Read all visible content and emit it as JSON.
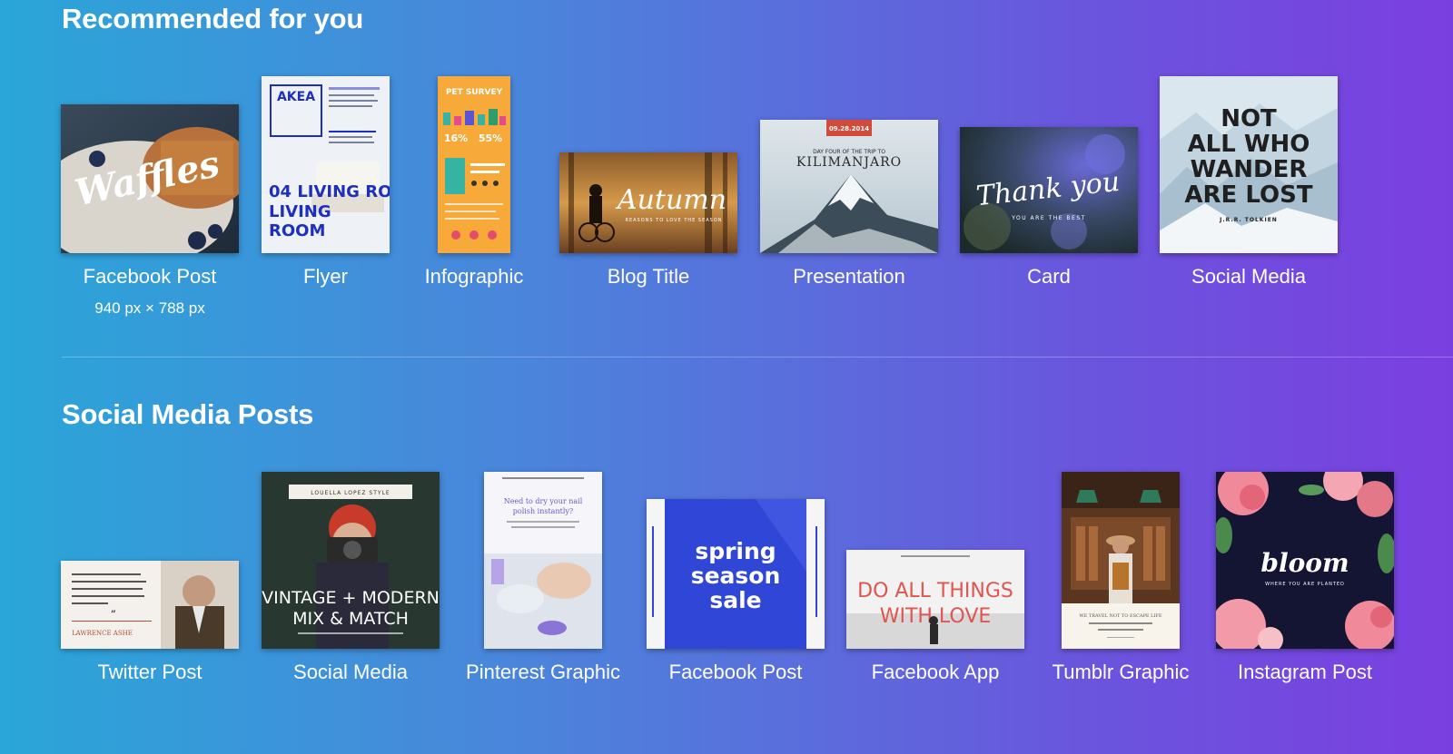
{
  "sections": [
    {
      "title": "Recommended for you",
      "items": [
        {
          "label": "Facebook Post",
          "sublabel": "940 px × 788 px",
          "thumb_text": "Waffles"
        },
        {
          "label": "Flyer",
          "thumb_text": "04 LIVING ROOM",
          "thumb_brand": "AKEA"
        },
        {
          "label": "Infographic",
          "thumb_text": "PET SURVEY",
          "thumb_stats": [
            "16%",
            "55%"
          ]
        },
        {
          "label": "Blog Title",
          "thumb_text": "Autumn",
          "thumb_subtext": "REASONS TO LOVE THE SEASON"
        },
        {
          "label": "Presentation",
          "thumb_text": "KILIMANJARO",
          "thumb_date": "09.28.2014",
          "thumb_subtext": "DAY FOUR OF THE TRIP TO"
        },
        {
          "label": "Card",
          "thumb_text": "Thank you",
          "thumb_subtext": "YOU ARE THE BEST"
        },
        {
          "label": "Social Media",
          "thumb_text": [
            "NOT",
            "ALL WHO",
            "WANDER",
            "ARE LOST"
          ],
          "thumb_subtext": "J.R.R. TOLKIEN"
        }
      ]
    },
    {
      "title": "Social Media Posts",
      "items": [
        {
          "label": "Twitter Post",
          "thumb_text": "LAWRENCE ASHE"
        },
        {
          "label": "Social Media",
          "thumb_text": [
            "VINTAGE + MODERN",
            "MIX & MATCH"
          ],
          "thumb_subtext": "LOUELLA LOPEZ STYLE"
        },
        {
          "label": "Pinterest Graphic",
          "thumb_text": [
            "Need to dry your nail",
            "polish instantly?"
          ]
        },
        {
          "label": "Facebook Post",
          "thumb_text": [
            "spring",
            "season",
            "sale"
          ]
        },
        {
          "label": "Facebook App",
          "thumb_text": [
            "DO ALL THINGS",
            "WITH LOVE"
          ]
        },
        {
          "label": "Tumblr Graphic",
          "thumb_text": "WE TRAVEL NOT TO ESCAPE LIFE"
        },
        {
          "label": "Instagram Post",
          "thumb_text": "bloom",
          "thumb_subtext": "WHERE YOU ARE PLANTED"
        }
      ]
    }
  ]
}
